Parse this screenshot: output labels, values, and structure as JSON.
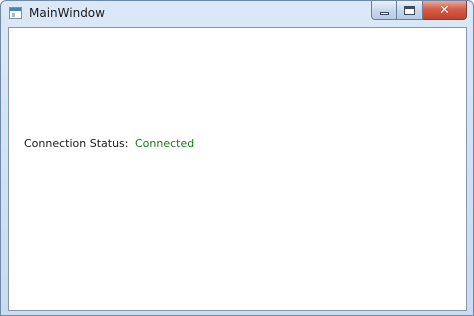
{
  "window": {
    "title": "MainWindow",
    "icon": "app-window-icon",
    "buttons": {
      "minimize": "minimize-icon",
      "maximize": "maximize-icon",
      "close": "close-icon",
      "close_glyph": "✕"
    }
  },
  "content": {
    "connection_status_label": "Connection Status:",
    "connection_status_value": "Connected",
    "connection_status_color": "#1a7a1a"
  }
}
